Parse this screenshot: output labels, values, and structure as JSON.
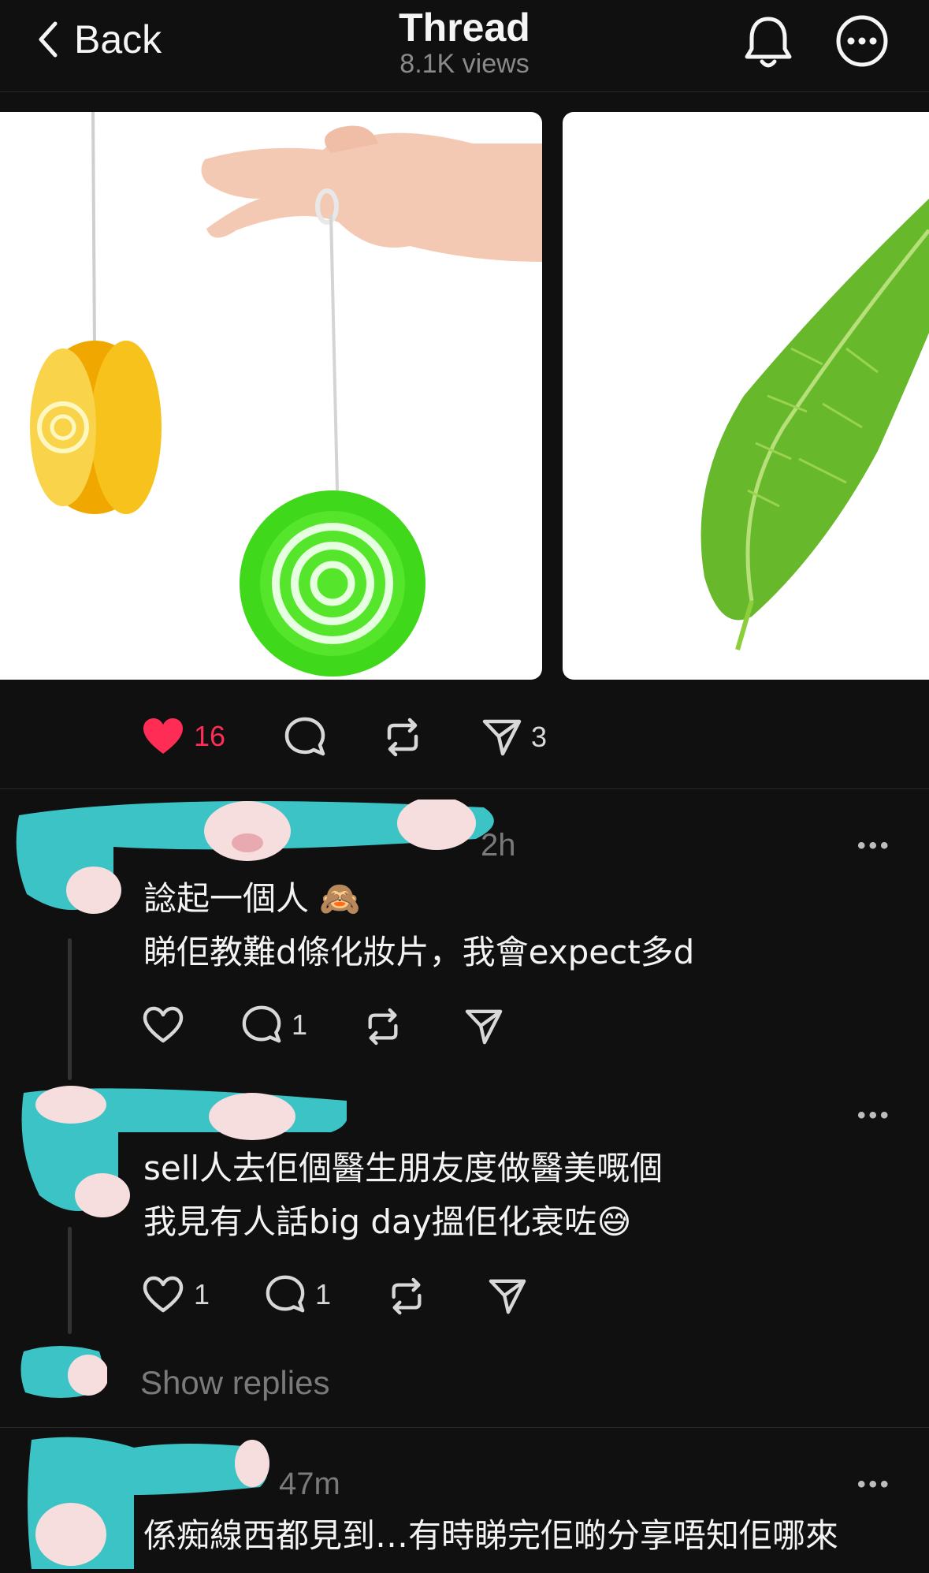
{
  "header": {
    "back_label": "Back",
    "title": "Thread",
    "views": "8.1K views"
  },
  "post": {
    "likes": "16",
    "shares": "3"
  },
  "comments": [
    {
      "time": "2h",
      "lines": [
        "諗起一個人 🙈",
        "睇佢教難d條化妝片，我會expect多d"
      ],
      "replies": "1"
    },
    {
      "lines": [
        "sell人去佢個醫生朋友度做醫美嘅個",
        "我見有人話big day搵佢化衰咗😅"
      ],
      "likes": "1",
      "replies": "1"
    },
    {
      "time": "47m",
      "lines": [
        "係痴線西都見到…有時睇完佢啲分享唔知佢哪來"
      ]
    }
  ],
  "show_replies": "Show replies",
  "colors": {
    "accent_like": "#ff2d55",
    "background": "#101010",
    "redaction": "#3cc3c5"
  }
}
